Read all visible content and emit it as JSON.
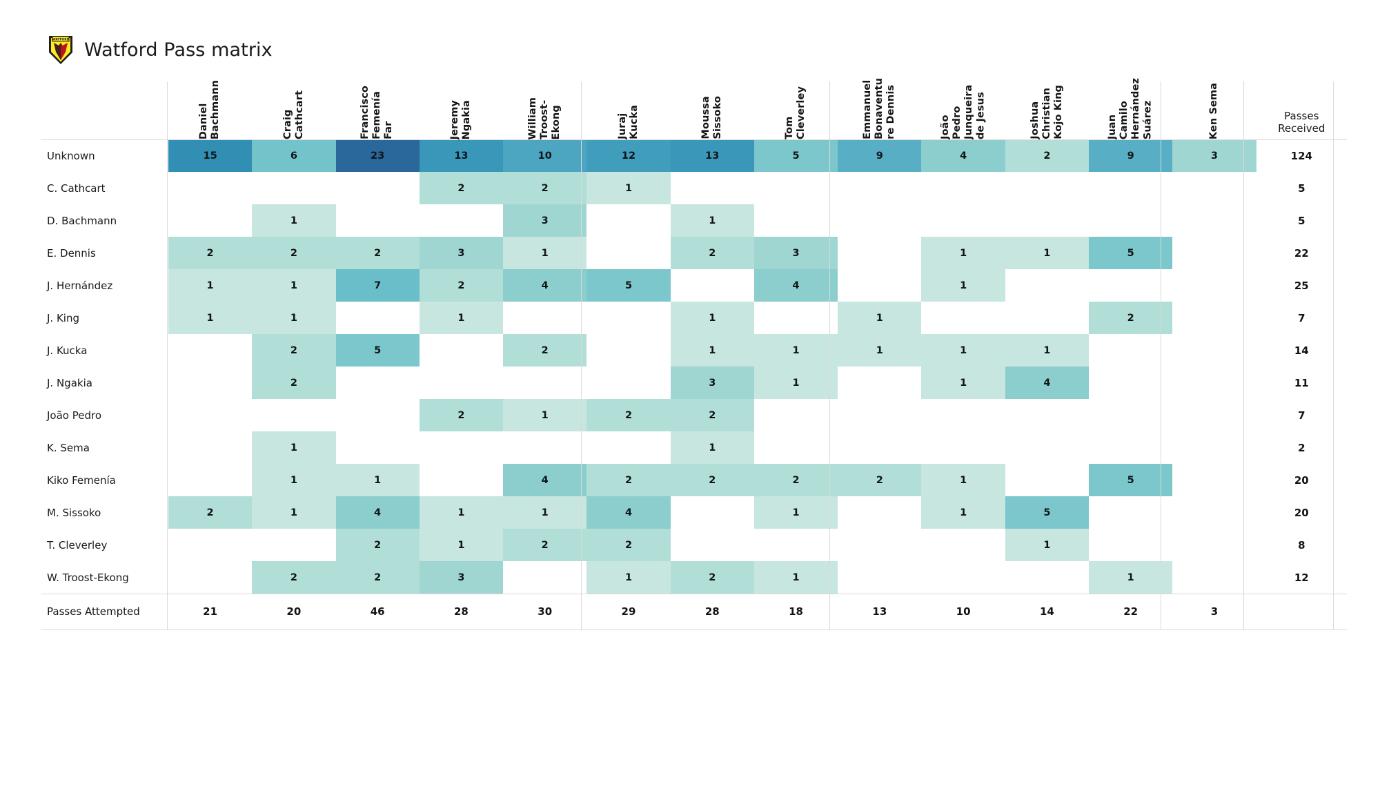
{
  "header": {
    "title": "Watford Pass matrix",
    "crest_alt": "watford-crest-icon",
    "crest_colors": {
      "shield_red": "#ED2127",
      "shield_yellow": "#FBEE23",
      "shield_dark": "#231F20"
    }
  },
  "table": {
    "received_header": "Passes\nReceived",
    "attempted_label": "Passes Attempted",
    "columns": [
      "Daniel\nBachmann",
      "Craig\nCathcart",
      "Francisco\nFemenía\nFar",
      "Jeremy\nNgakia",
      "William\nTroost-\nEkong",
      "Juraj\nKucka",
      "Moussa\nSissoko",
      "Tom\nCleverley",
      "Emmanuel\nBonaventu\nre Dennis",
      "João Pedro\nJunqueira\nde Jesus",
      "Joshua\nChristian\nKojo King",
      "Juan\nCamilo\nHernández\nSuárez",
      "Ken Sema"
    ],
    "rows": [
      "Unknown",
      "C. Cathcart",
      "D. Bachmann",
      "E. Dennis",
      "J. Hernández",
      "J. King",
      "J. Kucka",
      "J. Ngakia",
      "João Pedro",
      "K. Sema",
      "Kiko Femenía",
      "M. Sissoko",
      "T. Cleverley",
      "W. Troost-Ekong"
    ]
  },
  "chart_data": {
    "type": "heatmap",
    "title": "Watford Pass matrix",
    "xlabel": "",
    "ylabel": "",
    "legend": "none",
    "grid": false,
    "colorscale": {
      "empty": "#ffffff",
      "low": "#c6e6df",
      "mid": "#8fd0cf",
      "high": "#3e9dbb",
      "max": "#2a6b9e",
      "vmin": 0,
      "vmax": 23
    },
    "x": [
      "Daniel Bachmann",
      "Craig Cathcart",
      "Francisco Femenía Far",
      "Jeremy Ngakia",
      "William Troost-Ekong",
      "Juraj Kucka",
      "Moussa Sissoko",
      "Tom Cleverley",
      "Emmanuel Bonaventure Dennis",
      "João Pedro Junqueira de Jesus",
      "Joshua Christian Kojo King",
      "Juan Camilo Hernández Suárez",
      "Ken Sema"
    ],
    "y": [
      "Unknown",
      "C. Cathcart",
      "D. Bachmann",
      "E. Dennis",
      "J. Hernández",
      "J. King",
      "J. Kucka",
      "J. Ngakia",
      "João Pedro",
      "K. Sema",
      "Kiko Femenía",
      "M. Sissoko",
      "T. Cleverley",
      "W. Troost-Ekong"
    ],
    "values": [
      [
        15,
        6,
        23,
        13,
        10,
        12,
        13,
        5,
        9,
        4,
        2,
        9,
        3
      ],
      [
        null,
        null,
        null,
        2,
        2,
        1,
        null,
        null,
        null,
        null,
        null,
        null,
        null
      ],
      [
        null,
        1,
        null,
        null,
        3,
        null,
        1,
        null,
        null,
        null,
        null,
        null,
        null
      ],
      [
        2,
        2,
        2,
        3,
        1,
        null,
        2,
        3,
        null,
        1,
        1,
        5,
        null
      ],
      [
        1,
        1,
        7,
        2,
        4,
        5,
        null,
        4,
        null,
        1,
        null,
        null,
        null
      ],
      [
        1,
        1,
        null,
        1,
        null,
        null,
        1,
        null,
        1,
        null,
        null,
        2,
        null
      ],
      [
        null,
        2,
        5,
        null,
        2,
        null,
        1,
        1,
        1,
        1,
        1,
        null,
        null
      ],
      [
        null,
        2,
        null,
        null,
        null,
        null,
        3,
        1,
        null,
        1,
        4,
        null,
        null
      ],
      [
        null,
        null,
        null,
        2,
        1,
        2,
        2,
        null,
        null,
        null,
        null,
        null,
        null
      ],
      [
        null,
        1,
        null,
        null,
        null,
        null,
        1,
        null,
        null,
        null,
        null,
        null,
        null
      ],
      [
        null,
        1,
        1,
        null,
        4,
        2,
        2,
        2,
        2,
        1,
        null,
        5,
        null
      ],
      [
        2,
        1,
        4,
        1,
        1,
        4,
        null,
        1,
        null,
        1,
        5,
        null,
        null
      ],
      [
        null,
        null,
        2,
        1,
        2,
        2,
        null,
        null,
        null,
        null,
        1,
        null,
        null
      ],
      [
        null,
        2,
        2,
        3,
        null,
        1,
        2,
        1,
        null,
        null,
        null,
        1,
        null
      ]
    ],
    "passes_received": [
      124,
      5,
      5,
      22,
      25,
      7,
      14,
      11,
      7,
      2,
      20,
      20,
      8,
      12
    ],
    "passes_attempted": [
      21,
      20,
      46,
      28,
      30,
      29,
      28,
      18,
      13,
      10,
      14,
      22,
      3
    ]
  }
}
